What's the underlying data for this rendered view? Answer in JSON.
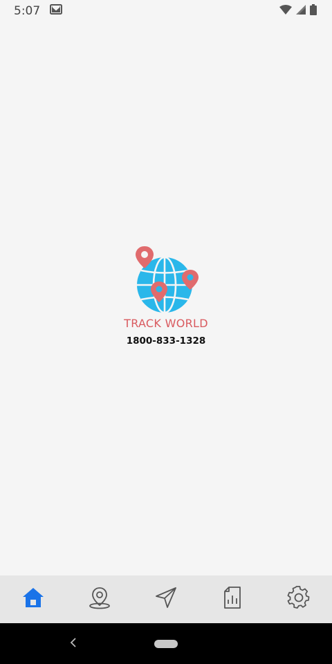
{
  "status_bar": {
    "time": "5:07",
    "icons": [
      "gmail-icon",
      "wifi-icon",
      "signal-icon",
      "battery-icon"
    ]
  },
  "splash": {
    "brand_name": "TRACK WORLD",
    "phone": "1800-833-1328",
    "logo_icon": "globe-with-map-pins-icon"
  },
  "bottom_nav": {
    "items": [
      {
        "icon": "home-icon",
        "active": true
      },
      {
        "icon": "location-pin-icon",
        "active": false
      },
      {
        "icon": "navigation-arrow-icon",
        "active": false
      },
      {
        "icon": "report-document-icon",
        "active": false
      },
      {
        "icon": "settings-gear-icon",
        "active": false
      }
    ]
  },
  "colors": {
    "active": "#1a73e8",
    "inactive": "#555555",
    "brand_red": "#d95a5f",
    "globe_blue": "#2ab7ea"
  }
}
